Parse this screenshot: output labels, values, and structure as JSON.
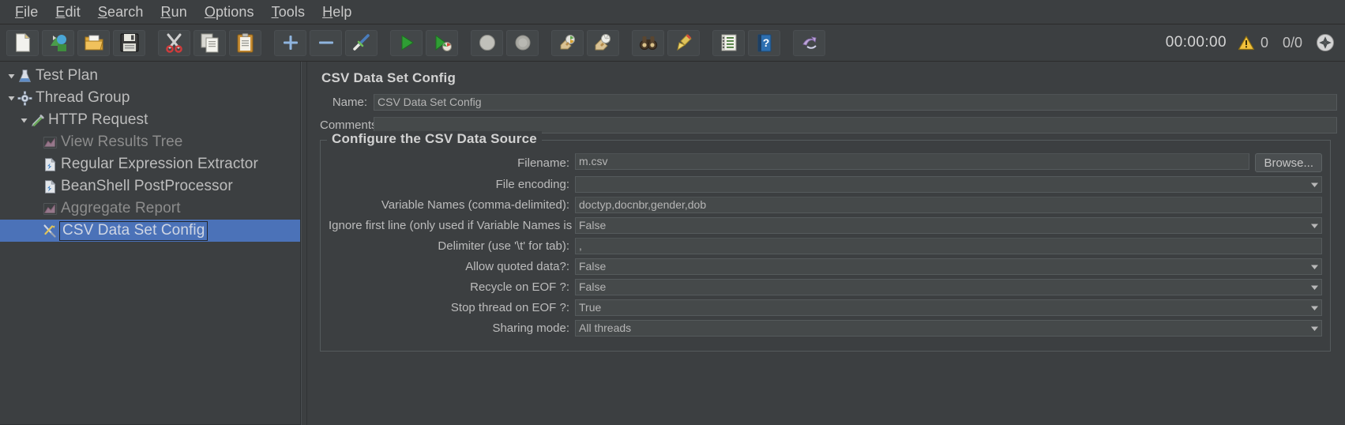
{
  "menu": {
    "items": [
      {
        "mnemonic": "F",
        "rest": "ile"
      },
      {
        "mnemonic": "E",
        "rest": "dit"
      },
      {
        "mnemonic": "S",
        "rest": "earch"
      },
      {
        "mnemonic": "R",
        "rest": "un"
      },
      {
        "mnemonic": "O",
        "rest": "ptions"
      },
      {
        "mnemonic": "T",
        "rest": "ools"
      },
      {
        "mnemonic": "H",
        "rest": "elp"
      }
    ]
  },
  "toolbar": {
    "buttons": [
      {
        "name": "new-button",
        "icon": "new-document-icon",
        "tooltip": "New"
      },
      {
        "name": "templates-button",
        "icon": "templates-icon",
        "tooltip": "Templates"
      },
      {
        "name": "open-button",
        "icon": "open-folder-icon",
        "tooltip": "Open"
      },
      {
        "name": "save-button",
        "icon": "save-floppy-icon",
        "tooltip": "Save Test Plan"
      },
      {
        "name": "cut-button",
        "icon": "scissors-icon",
        "tooltip": "Cut"
      },
      {
        "name": "copy-button",
        "icon": "copy-icon",
        "tooltip": "Copy"
      },
      {
        "name": "paste-button",
        "icon": "clipboard-paste-icon",
        "tooltip": "Paste"
      },
      {
        "name": "expand-all-button",
        "icon": "plus-icon",
        "tooltip": "Expand All"
      },
      {
        "name": "collapse-all-button",
        "icon": "minus-icon",
        "tooltip": "Collapse All"
      },
      {
        "name": "toggle-button",
        "icon": "toggle-icon",
        "tooltip": "Toggle"
      },
      {
        "name": "start-button",
        "icon": "green-play-icon",
        "tooltip": "Start"
      },
      {
        "name": "start-no-pauses-button",
        "icon": "green-play-no-pause-icon",
        "tooltip": "Start no pauses"
      },
      {
        "name": "stop-button",
        "icon": "stop-circle-icon",
        "tooltip": "Stop"
      },
      {
        "name": "shutdown-button",
        "icon": "shutdown-circle-icon",
        "tooltip": "Shutdown"
      },
      {
        "name": "clear-button",
        "icon": "clear-icon",
        "tooltip": "Clear"
      },
      {
        "name": "clear-all-button",
        "icon": "clear-all-icon",
        "tooltip": "Clear All"
      },
      {
        "name": "search-button",
        "icon": "binoculars-icon",
        "tooltip": "Search"
      },
      {
        "name": "reset-search-button",
        "icon": "broom-icon",
        "tooltip": "Reset Search"
      },
      {
        "name": "function-helper-button",
        "icon": "list-icon",
        "tooltip": "Function Helper Dialog"
      },
      {
        "name": "help-button",
        "icon": "help-book-icon",
        "tooltip": "Help"
      },
      {
        "name": "undo-button",
        "icon": "undo-icon",
        "tooltip": "Undo"
      }
    ],
    "timer": "00:00:00",
    "warning_count": "0",
    "thread_ratio": "0/0",
    "warning_icon": "warning-triangle-icon",
    "connect_icon": "remote-connect-icon",
    "accent": "#4b72b8"
  },
  "tree": {
    "items": [
      {
        "label": "Test Plan",
        "icon": "test-plan-icon",
        "indent": 1,
        "expanded": true,
        "disabled": false,
        "selected": false
      },
      {
        "label": "Thread Group",
        "icon": "thread-group-gear-icon",
        "indent": 1,
        "expanded": true,
        "disabled": false,
        "selected": false
      },
      {
        "label": "HTTP Request",
        "icon": "http-request-icon",
        "indent": 2,
        "expanded": true,
        "disabled": false,
        "selected": false
      },
      {
        "label": "View Results Tree",
        "icon": "results-tree-icon",
        "indent": 3,
        "expanded": null,
        "disabled": true,
        "selected": false
      },
      {
        "label": "Regular Expression Extractor",
        "icon": "post-processor-icon",
        "indent": 3,
        "expanded": null,
        "disabled": false,
        "selected": false
      },
      {
        "label": "BeanShell PostProcessor",
        "icon": "post-processor-icon",
        "indent": 3,
        "expanded": null,
        "disabled": false,
        "selected": false
      },
      {
        "label": "Aggregate Report",
        "icon": "results-tree-icon",
        "indent": 3,
        "expanded": null,
        "disabled": true,
        "selected": false
      },
      {
        "label": "CSV Data Set Config",
        "icon": "csv-config-icon",
        "indent": 3,
        "expanded": null,
        "disabled": false,
        "selected": true
      }
    ]
  },
  "detail": {
    "title": "CSV Data Set Config",
    "name_label": "Name:",
    "name_value": "CSV Data Set Config",
    "comments_label": "Comments:",
    "comments_value": "",
    "group_title": "Configure the CSV Data Source",
    "browse_label": "Browse...",
    "fields": [
      {
        "label": "Filename:",
        "value": "m.csv",
        "type": "text",
        "has_browse": true
      },
      {
        "label": "File encoding:",
        "value": "",
        "type": "combo",
        "has_browse": false
      },
      {
        "label": "Variable Names (comma-delimited):",
        "value": "doctyp,docnbr,gender,dob",
        "type": "text",
        "has_browse": false
      },
      {
        "label": "Ignore first line (only used if Variable Names is not empty):",
        "value": "False",
        "type": "combo",
        "has_browse": false
      },
      {
        "label": "Delimiter (use '\\t' for tab):",
        "value": ",",
        "type": "text",
        "has_browse": false
      },
      {
        "label": "Allow quoted data?:",
        "value": "False",
        "type": "combo",
        "has_browse": false
      },
      {
        "label": "Recycle on EOF ?:",
        "value": "False",
        "type": "combo",
        "has_browse": false
      },
      {
        "label": "Stop thread on EOF ?:",
        "value": "True",
        "type": "combo",
        "has_browse": false
      },
      {
        "label": "Sharing mode:",
        "value": "All threads",
        "type": "combo",
        "has_browse": false
      }
    ]
  }
}
